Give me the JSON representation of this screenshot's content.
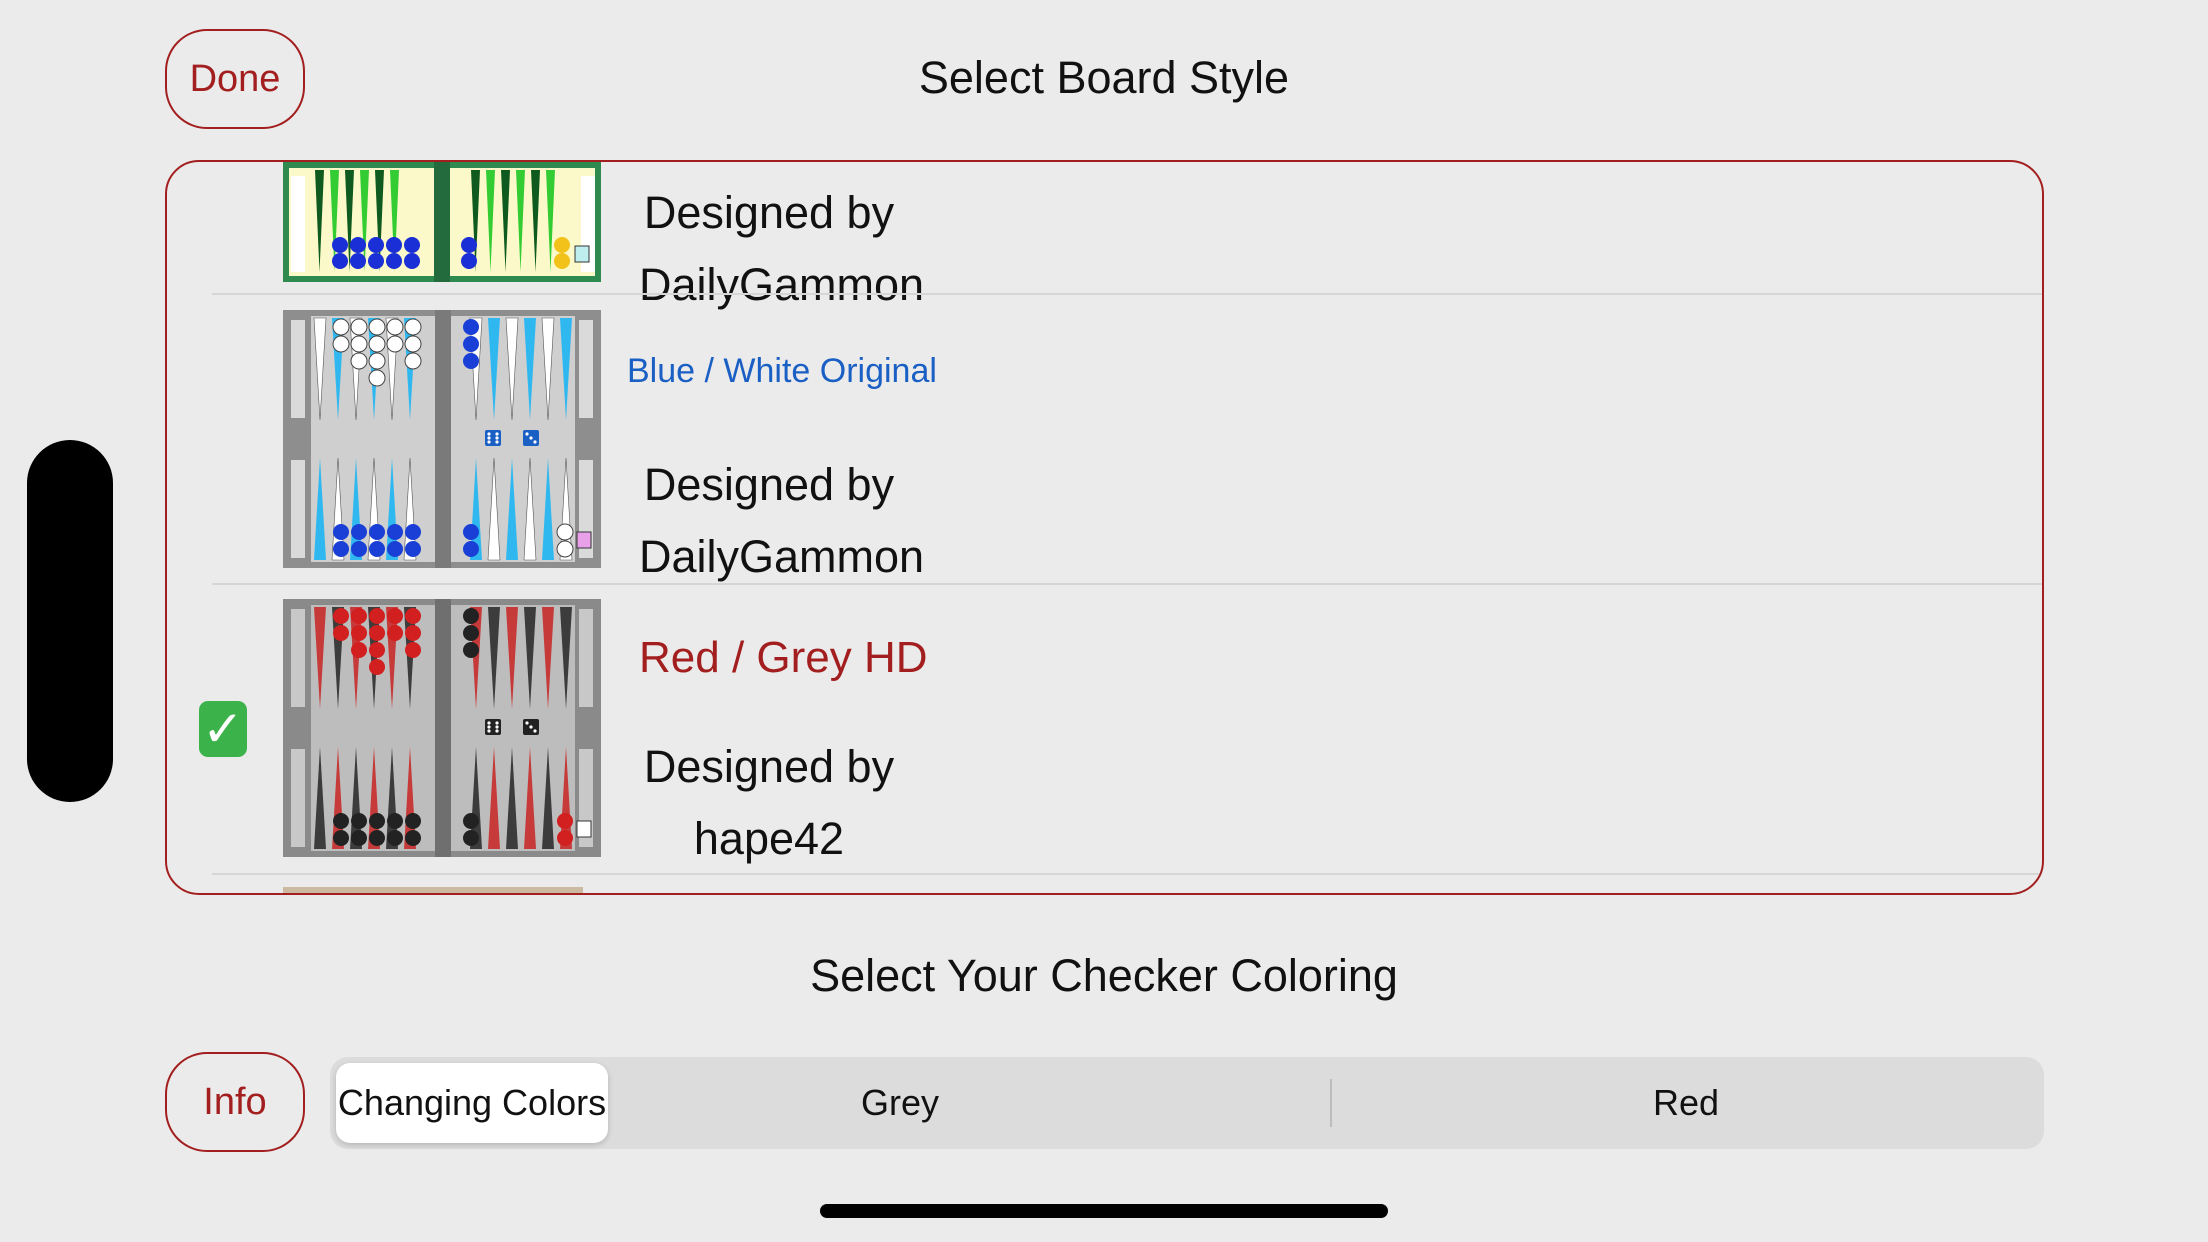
{
  "header": {
    "done_label": "Done",
    "title": "Select Board Style"
  },
  "boards": [
    {
      "name": "",
      "designed_by": "Designed by",
      "designer": "DailyGammon",
      "selected": false,
      "theme": "green"
    },
    {
      "name": "Blue / White Original",
      "name_color": "#1a5fc4",
      "designed_by": "Designed by",
      "designer": "DailyGammon",
      "selected": false,
      "theme": "blue"
    },
    {
      "name": "Red / Grey HD",
      "name_color": "#a31f1f",
      "designed_by": "Designed by",
      "designer": "hape42",
      "selected": true,
      "theme": "red"
    }
  ],
  "checker_section": {
    "title": "Select Your Checker Coloring",
    "info_label": "Info",
    "options": [
      "Changing Colors",
      "Grey",
      "Red"
    ],
    "selected": "Changing Colors"
  },
  "colors": {
    "accent": "#a31f1f",
    "link_blue": "#1a5fc4",
    "background": "#ebebeb"
  },
  "icons": {
    "selected_mark": "check-mark-icon"
  }
}
